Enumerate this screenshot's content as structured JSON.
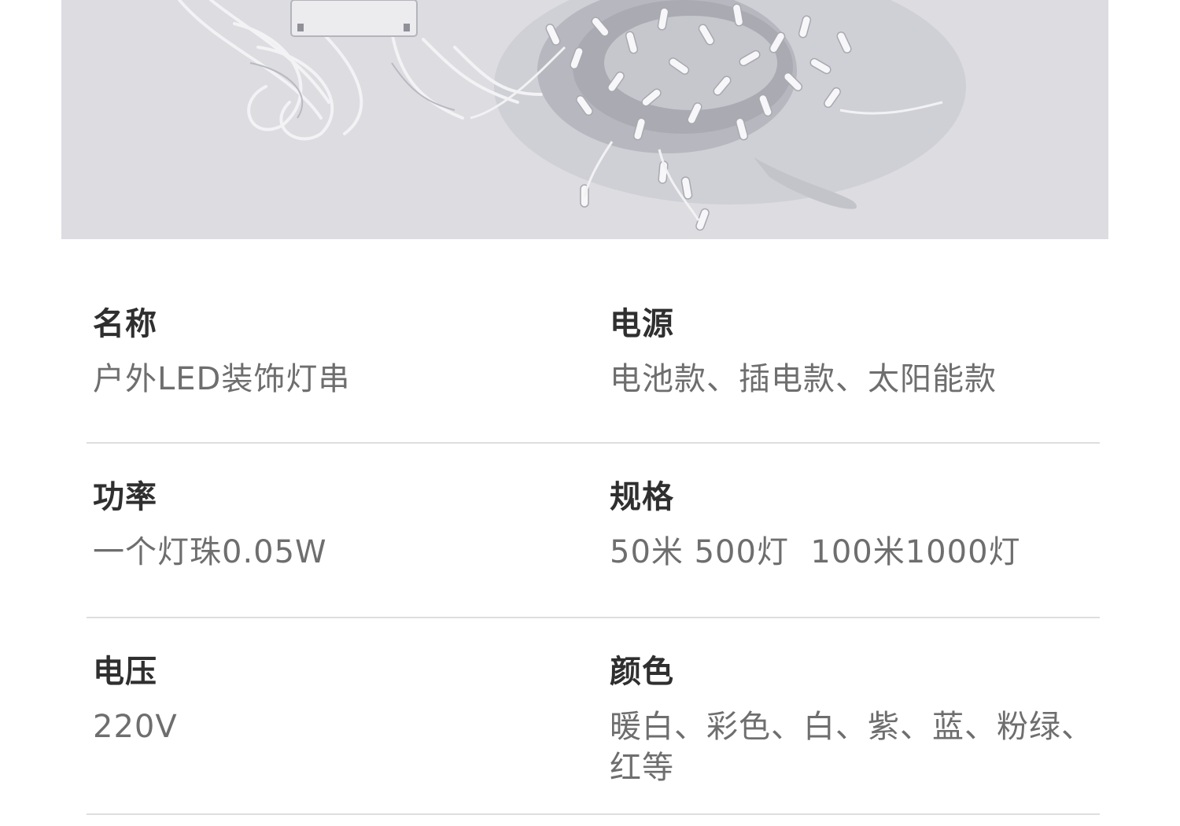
{
  "hero": {
    "image": "product-photo",
    "background": "#dcdce1"
  },
  "specs": [
    {
      "left": {
        "label": "名称",
        "value": "户外LED装饰灯串"
      },
      "right": {
        "label": "电源",
        "value": "电池款、插电款、太阳能款"
      }
    },
    {
      "left": {
        "label": "功率",
        "value": "一个灯珠0.05W"
      },
      "right": {
        "label": "规格",
        "value": "50米 500灯  100米1000灯"
      }
    },
    {
      "left": {
        "label": "电压",
        "value": "220V"
      },
      "right": {
        "label": "颜色",
        "value": "暖白、彩色、白、紫、蓝、粉绿、红等"
      }
    }
  ],
  "colors": {
    "label": "#2f2f2f",
    "value": "#6e6e6e",
    "divider": "#dedede"
  }
}
